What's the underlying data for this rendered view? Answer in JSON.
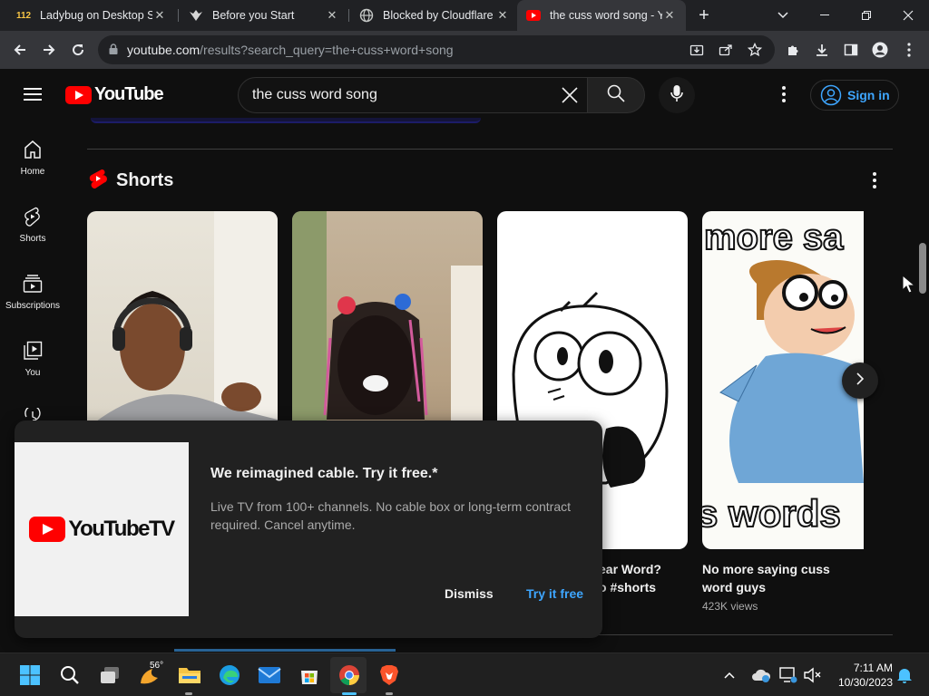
{
  "browser": {
    "tabs": [
      {
        "title": "Ladybug on Desktop S",
        "favicon": "ladybug-favicon"
      },
      {
        "title": "Before you Start",
        "favicon": "warframe-favicon"
      },
      {
        "title": "Blocked by Cloudflare",
        "favicon": "globe-favicon"
      },
      {
        "title": "the cuss word song - Y",
        "favicon": "youtube-favicon",
        "active": true
      }
    ],
    "url_host": "youtube.com",
    "url_path": "/results?search_query=the+cuss+word+song"
  },
  "youtube": {
    "logo_text": "YouTube",
    "search_query": "the cuss word song",
    "signin_label": "Sign in",
    "guide": [
      {
        "label": "Home",
        "icon": "home-icon"
      },
      {
        "label": "Shorts",
        "icon": "shorts-icon"
      },
      {
        "label": "Subscriptions",
        "icon": "subscriptions-icon"
      },
      {
        "label": "You",
        "icon": "you-icon"
      }
    ],
    "shelf_title": "Shorts",
    "shorts": [
      {
        "title": "",
        "views": ""
      },
      {
        "title": "",
        "views": ""
      },
      {
        "title": "...ear Word? ...o #shorts",
        "title_line1": "ear Word?",
        "title_line2": "o #shorts",
        "views": "",
        "thumb_text": ""
      },
      {
        "title": "No more saying cuss word guys",
        "views": "423K views",
        "thumb_top_text": "more sa",
        "thumb_bottom_text": "s words"
      }
    ]
  },
  "promo": {
    "logo_text": "YouTubeTV",
    "title": "We reimagined cable. Try it free.*",
    "body": "Live TV from 100+ channels. No cable box or long-term contract required. Cancel anytime.",
    "dismiss_label": "Dismiss",
    "try_label": "Try it free"
  },
  "taskbar": {
    "weather": "56°",
    "time": "7:11 AM",
    "date": "10/30/2023"
  },
  "colors": {
    "accent_blue": "#3ea6ff",
    "youtube_red": "#ff0000",
    "background": "#0f0f0f"
  }
}
